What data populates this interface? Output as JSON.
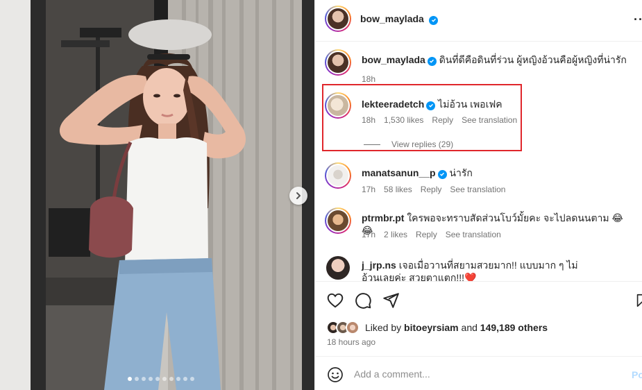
{
  "post": {
    "author": "bow_maylada",
    "photo_count": 10,
    "active_photo_index": 0
  },
  "caption": {
    "username": "bow_maylada",
    "text": "ดินที่ดีคือดินที่ร่วน ผู้หญิงอ้วนคือผู้หญิงที่น่ารัก",
    "time": "18h"
  },
  "comments": [
    {
      "username": "lekteeradetch",
      "verified": true,
      "text": "ไม่อ้วน เพอเฟค",
      "time": "18h",
      "likes": "1,530 likes",
      "reply": "Reply",
      "translate": "See translation",
      "view_replies": "View replies (29)",
      "highlighted": true
    },
    {
      "username": "manatsanun__p",
      "verified": true,
      "text": "น่ารัก",
      "time": "17h",
      "likes": "58 likes",
      "reply": "Reply",
      "translate": "See translation"
    },
    {
      "username": "ptrmbr.pt",
      "verified": false,
      "text": "ใครพอจะทราบสัดส่วนโบว์มั้ยคะ จะไปลดนนตาม 😂😂",
      "time": "17h",
      "likes": "2 likes",
      "reply": "Reply",
      "translate": "See translation"
    },
    {
      "username": "j_jrp.ns",
      "verified": false,
      "text": "เจอเมื่อวานที่สยามสวยมาก!! แบบมาก ๆ ไม่อ้วนเลยค่ะ สวยตาแตก!!!❤️"
    }
  ],
  "likes": {
    "prefix": "Liked by",
    "user": "bitoeyrsiam",
    "middle": "and",
    "others": "149,189 others",
    "time_ago": "18 hours ago"
  },
  "comment_input": {
    "placeholder": "Add a comment...",
    "post_label": "Po"
  },
  "colors": {
    "verified": "#0095f6",
    "highlight_border": "#e0262b",
    "meta_text": "#737373"
  },
  "icons": [
    "verified-icon",
    "more-options-icon",
    "heart-icon",
    "comment-icon",
    "share-icon",
    "bookmark-icon",
    "emoji-icon",
    "next-arrow-icon"
  ]
}
